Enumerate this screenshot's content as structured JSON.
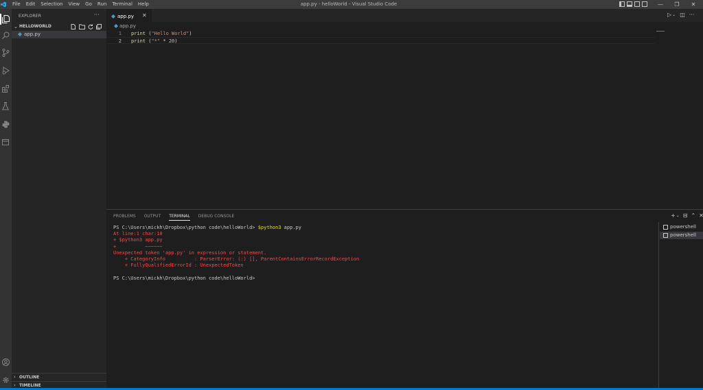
{
  "titlebar": {
    "title": "app.py - helloWorld - Visual Studio Code",
    "menu": [
      "File",
      "Edit",
      "Selection",
      "View",
      "Go",
      "Run",
      "Terminal",
      "Help"
    ],
    "window_buttons": [
      "—",
      "❐",
      "✕"
    ]
  },
  "sidebar": {
    "header": "EXPLORER",
    "more": "···",
    "folder": "HELLOWORLD",
    "files": [
      {
        "name": "app.py"
      }
    ],
    "sections": [
      "OUTLINE",
      "TIMELINE"
    ]
  },
  "editor": {
    "tab": {
      "label": "app.py",
      "close": "✕"
    },
    "breadcrumb": "app.py",
    "lines": [
      {
        "number": "1",
        "fn": "print",
        "open": " (",
        "str": "\"Hello World\"",
        "rest": ")"
      },
      {
        "number": "2",
        "fn": "print",
        "open": " (",
        "str": "\"*\"",
        "rest": " * ",
        "num": "20",
        "close": ")"
      }
    ]
  },
  "panel": {
    "tabs": [
      "PROBLEMS",
      "OUTPUT",
      "TERMINAL",
      "DEBUG CONSOLE"
    ],
    "active_tab": "TERMINAL",
    "actions": [
      "+",
      "⌄",
      "⊟",
      "⌃",
      "✕"
    ],
    "terminal": {
      "prompt1": "PS C:\\Users\\mickh\\Dropbox\\python code\\helloWorld> ",
      "cmd": "$python3",
      "arg": " app.py",
      "errors": [
        "At line:1 char:10",
        "+ $python3 app.py",
        "+          ~~~~~~",
        "Unexpected token 'app.py' in expression or statement.",
        "    + CategoryInfo          : ParserError: (:) [], ParentContainsErrorRecordException",
        "    + FullyQualifiedErrorId : UnexpectedToken"
      ],
      "prompt2": "PS C:\\Users\\mickh\\Dropbox\\python code\\helloWorld>"
    },
    "terminal_list": [
      "powershell",
      "powershell"
    ]
  },
  "colors": {
    "accent": "#007acc",
    "python_icon": "#519aba",
    "error": "#f14c4c"
  }
}
